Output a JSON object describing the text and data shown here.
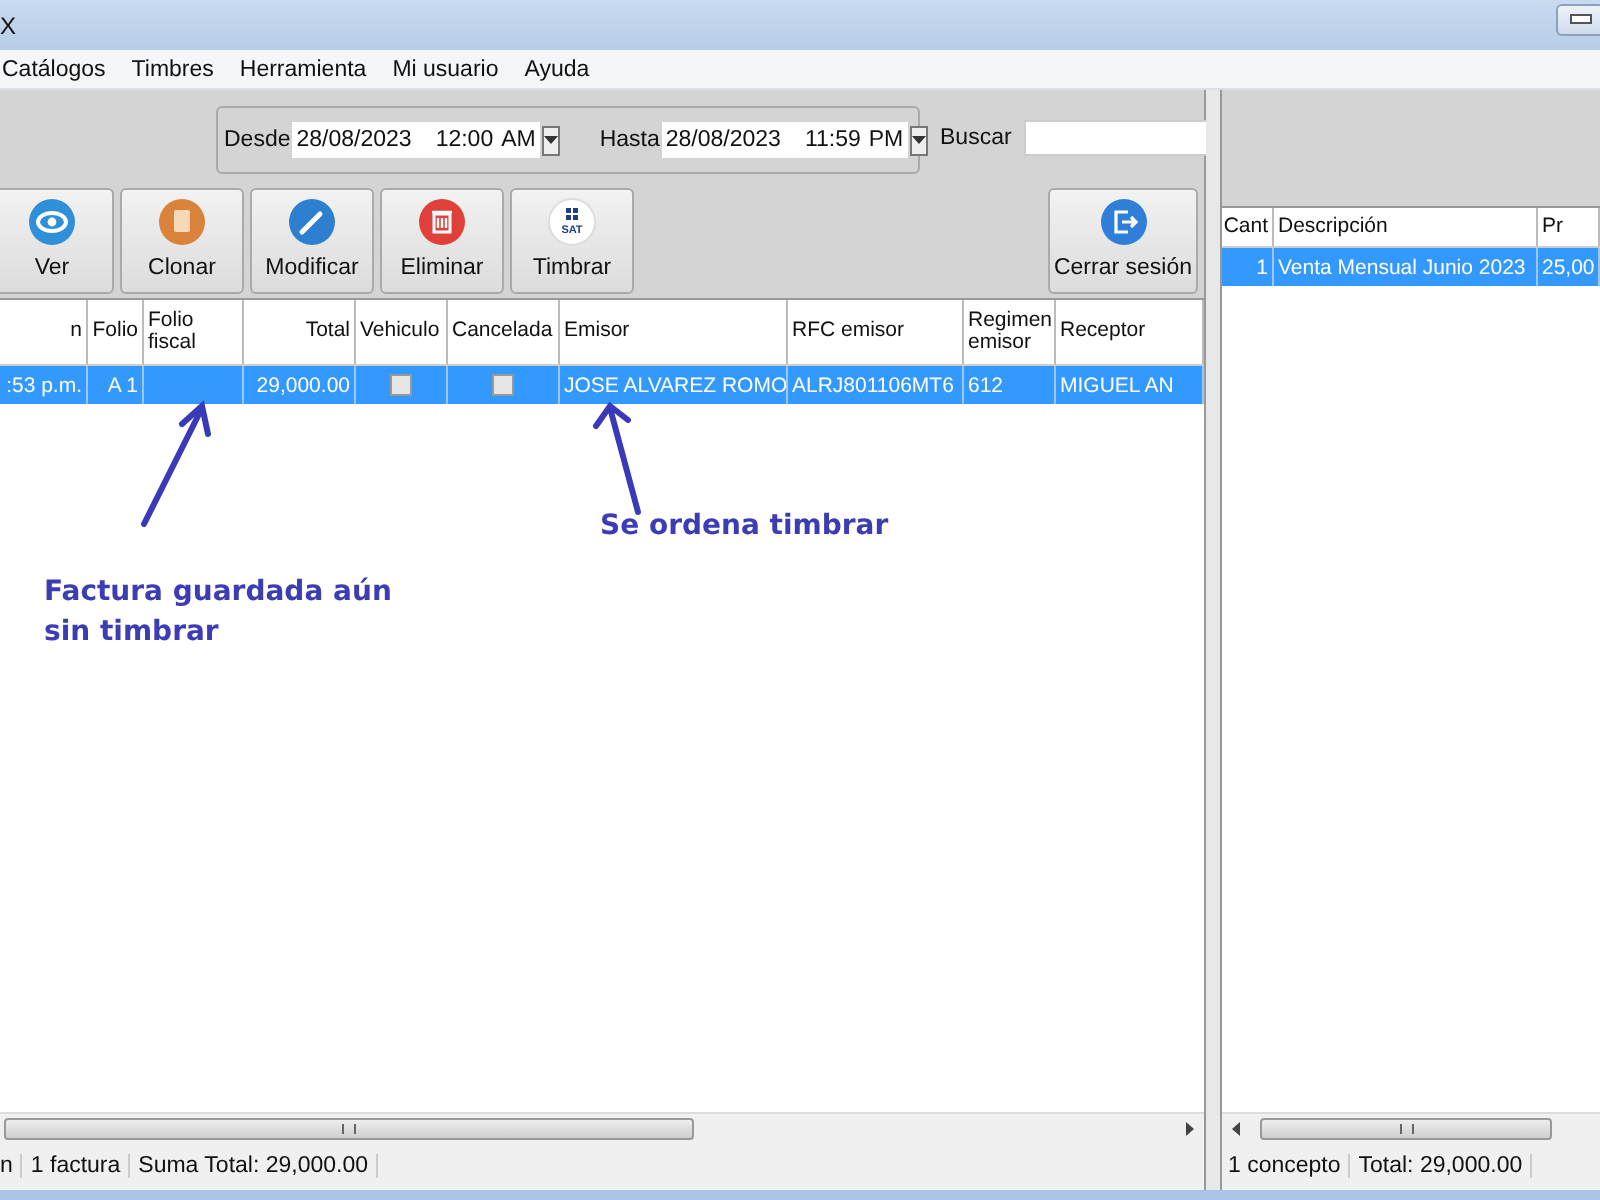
{
  "window": {
    "title": "X"
  },
  "menu": [
    {
      "label": "Catálogos"
    },
    {
      "label": "Timbres"
    },
    {
      "label": "Herramienta"
    },
    {
      "label": "Mi usuario"
    },
    {
      "label": "Ayuda"
    }
  ],
  "filters": {
    "from_label": "Desde",
    "from_date": "28/08/2023",
    "from_time": "12:00",
    "from_ampm": "AM",
    "to_label": "Hasta",
    "to_date": "28/08/2023",
    "to_time": "11:59",
    "to_ampm": "PM",
    "search_label": "Buscar"
  },
  "toolbar": [
    {
      "label": "Ver"
    },
    {
      "label": "Clonar"
    },
    {
      "label": "Modificar"
    },
    {
      "label": "Eliminar"
    },
    {
      "label": "Timbrar",
      "icon_text": "SAT"
    }
  ],
  "logout": {
    "label": "Cerrar sesión"
  },
  "invoices": {
    "columns": [
      {
        "label": "n",
        "kind": "number"
      },
      {
        "label": "Folio",
        "kind": "number"
      },
      {
        "label": "Folio fiscal",
        "kind": "text"
      },
      {
        "label": "Total",
        "kind": "number"
      },
      {
        "label": "Vehiculo",
        "kind": "check"
      },
      {
        "label": "Cancelada",
        "kind": "check"
      },
      {
        "label": "Emisor",
        "kind": "text"
      },
      {
        "label": "RFC emisor",
        "kind": "text"
      },
      {
        "label": "Regimen emisor",
        "kind": "text"
      },
      {
        "label": "Receptor",
        "kind": "text"
      }
    ],
    "rows": [
      {
        "selected": true,
        "cells": [
          ":53 p.m.",
          "A 1",
          "",
          "29,000.00",
          false,
          false,
          "JOSE ALVAREZ ROMO",
          "ALRJ801106MT6",
          "612",
          "MIGUEL AN"
        ]
      }
    ]
  },
  "status": [
    "n",
    "1 factura",
    "Suma Total: 29,000.00"
  ],
  "concepts": {
    "columns": [
      {
        "label": "Cant",
        "kind": "number"
      },
      {
        "label": "Descripción",
        "kind": "text"
      },
      {
        "label": "Pr",
        "kind": "text"
      }
    ],
    "rows": [
      {
        "selected": true,
        "cells": [
          "1",
          "Venta Mensual Junio 2023",
          "25,00"
        ]
      }
    ]
  },
  "concepts_status": [
    "1 concepto",
    "Total: 29,000.00"
  ],
  "annotations": [
    {
      "text": "Factura guardada aún sin timbrar"
    },
    {
      "text": "Se ordena timbrar"
    }
  ]
}
